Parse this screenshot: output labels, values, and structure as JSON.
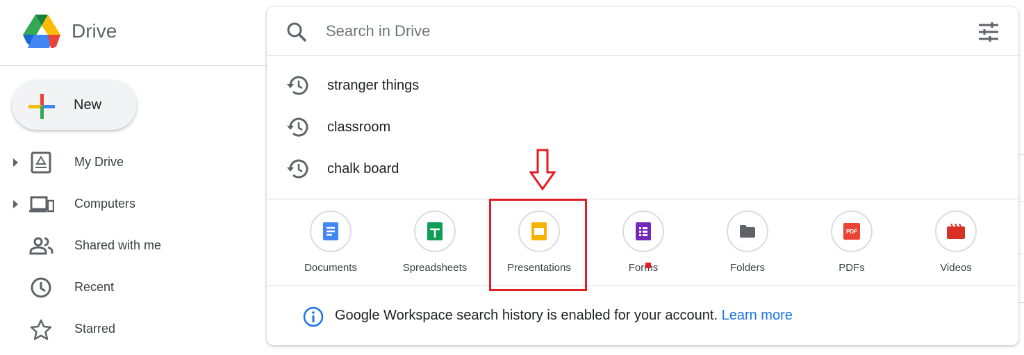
{
  "app": {
    "name": "Drive"
  },
  "sidebar": {
    "new_label": "New",
    "items": [
      {
        "label": "My Drive",
        "icon": "my-drive-icon",
        "expandable": true
      },
      {
        "label": "Computers",
        "icon": "computers-icon",
        "expandable": true
      },
      {
        "label": "Shared with me",
        "icon": "shared-icon",
        "expandable": false
      },
      {
        "label": "Recent",
        "icon": "clock-icon",
        "expandable": false
      },
      {
        "label": "Starred",
        "icon": "star-icon",
        "expandable": false
      }
    ]
  },
  "search": {
    "placeholder": "Search in Drive",
    "value": "",
    "history": [
      "stranger things",
      "classroom",
      "chalk board"
    ],
    "types": [
      {
        "label": "Documents",
        "color": "#4285f4"
      },
      {
        "label": "Spreadsheets",
        "color": "#0f9d58"
      },
      {
        "label": "Presentations",
        "color": "#f4b400"
      },
      {
        "label": "Forms",
        "color": "#7627bb"
      },
      {
        "label": "Folders",
        "color": "#5f6368"
      },
      {
        "label": "PDFs",
        "color": "#ea4335"
      },
      {
        "label": "Videos",
        "color": "#d93025"
      }
    ],
    "pdf_badge": "PDF",
    "info_text": "Google Workspace search history is enabled for your account.",
    "learn_more": "Learn more"
  },
  "annotation": {
    "highlight_color": "#e21d23",
    "highlighted": "Presentations"
  }
}
